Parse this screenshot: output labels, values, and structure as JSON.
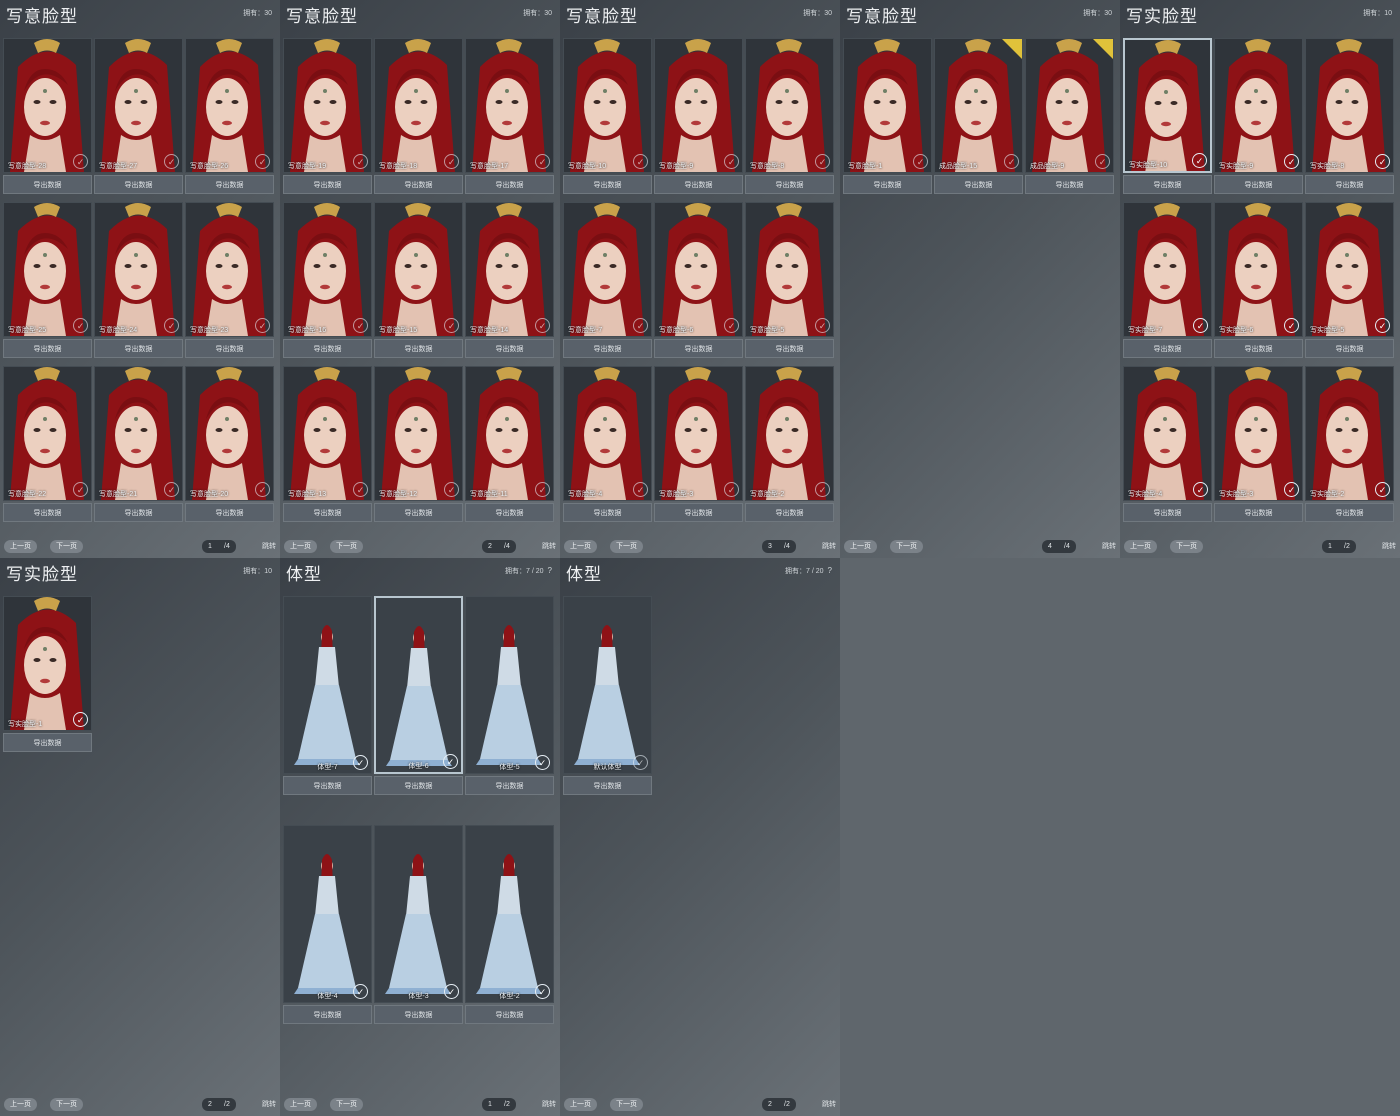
{
  "colors": {
    "hair": "#8e1216",
    "gold": "#c9a24a",
    "skin": "#ecd0c0",
    "dress": "#b9cfe2",
    "check": "#e6eef5"
  },
  "labels": {
    "export": "导出数据",
    "prev": "上一页",
    "next": "下一页",
    "jump": "跳转",
    "owned_prefix": "拥有：",
    "help": "?"
  },
  "panels": [
    {
      "title": "写意脸型",
      "owned": "30",
      "page": "1",
      "pages": "/4",
      "cards": [
        {
          "name": "写意脸型-28",
          "check": false
        },
        {
          "name": "写意脸型-27",
          "check": false
        },
        {
          "name": "写意脸型-26",
          "check": false
        },
        {
          "name": "写意脸型-25",
          "check": false
        },
        {
          "name": "写意脸型-24",
          "check": false
        },
        {
          "name": "写意脸型-23",
          "check": false
        },
        {
          "name": "写意脸型-22",
          "check": false
        },
        {
          "name": "写意脸型-21",
          "check": false
        },
        {
          "name": "写意脸型-20",
          "check": false
        }
      ]
    },
    {
      "title": "写意脸型",
      "owned": "30",
      "page": "2",
      "pages": "/4",
      "cards": [
        {
          "name": "写意脸型-19",
          "check": false
        },
        {
          "name": "写意脸型-18",
          "check": false
        },
        {
          "name": "写意脸型-17",
          "check": false
        },
        {
          "name": "写意脸型-16",
          "check": false
        },
        {
          "name": "写意脸型-15",
          "check": false
        },
        {
          "name": "写意脸型-14",
          "check": false
        },
        {
          "name": "写意脸型-13",
          "check": false
        },
        {
          "name": "写意脸型-12",
          "check": false
        },
        {
          "name": "写意脸型-11",
          "check": false
        }
      ]
    },
    {
      "title": "写意脸型",
      "owned": "30",
      "page": "3",
      "pages": "/4",
      "cards": [
        {
          "name": "写意脸型-10",
          "check": false
        },
        {
          "name": "写意脸型-9",
          "check": false
        },
        {
          "name": "写意脸型-8",
          "check": false
        },
        {
          "name": "写意脸型-7",
          "check": false
        },
        {
          "name": "写意脸型-6",
          "check": false
        },
        {
          "name": "写意脸型-5",
          "check": false
        },
        {
          "name": "写意脸型-4",
          "check": false
        },
        {
          "name": "写意脸型-3",
          "check": false
        },
        {
          "name": "写意脸型-2",
          "check": false
        }
      ]
    },
    {
      "title": "写意脸型",
      "owned": "30",
      "page": "4",
      "pages": "/4",
      "cards": [
        {
          "name": "写意脸型-1",
          "check": false
        },
        {
          "name": "成品脸型-15",
          "check": false,
          "tag": true
        },
        {
          "name": "成品脸型-9",
          "check": false,
          "tag": true
        }
      ]
    },
    {
      "title": "写实脸型",
      "owned": "10",
      "page": "1",
      "pages": "/2",
      "selectedIndex": 0,
      "cards": [
        {
          "name": "写实脸型-10",
          "check": true
        },
        {
          "name": "写实脸型-9",
          "check": true
        },
        {
          "name": "写实脸型-8",
          "check": true
        },
        {
          "name": "写实脸型-7",
          "check": true
        },
        {
          "name": "写实脸型-6",
          "check": true
        },
        {
          "name": "写实脸型-5",
          "check": true
        },
        {
          "name": "写实脸型-4",
          "check": true
        },
        {
          "name": "写实脸型-3",
          "check": true
        },
        {
          "name": "写实脸型-2",
          "check": true
        }
      ]
    },
    {
      "title": "写实脸型",
      "owned": "10",
      "page": "2",
      "pages": "/2",
      "cards": [
        {
          "name": "写实脸型-1",
          "check": true
        }
      ]
    },
    {
      "title": "体型",
      "owned": "7 / 20",
      "help": true,
      "body": true,
      "page": "1",
      "pages": "/2",
      "selectedIndex": 1,
      "cards": [
        {
          "name": "体型-7",
          "check": true
        },
        {
          "name": "体型-6",
          "check": true
        },
        {
          "name": "体型-5",
          "check": true
        },
        {
          "name": "体型-4",
          "check": true
        },
        {
          "name": "体型-3",
          "check": true
        },
        {
          "name": "体型-2",
          "check": true
        }
      ]
    },
    {
      "title": "体型",
      "owned": "7 / 20",
      "help": true,
      "body": true,
      "page": "2",
      "pages": "/2",
      "cards": [
        {
          "name": "默认体型",
          "check": false
        }
      ]
    }
  ]
}
